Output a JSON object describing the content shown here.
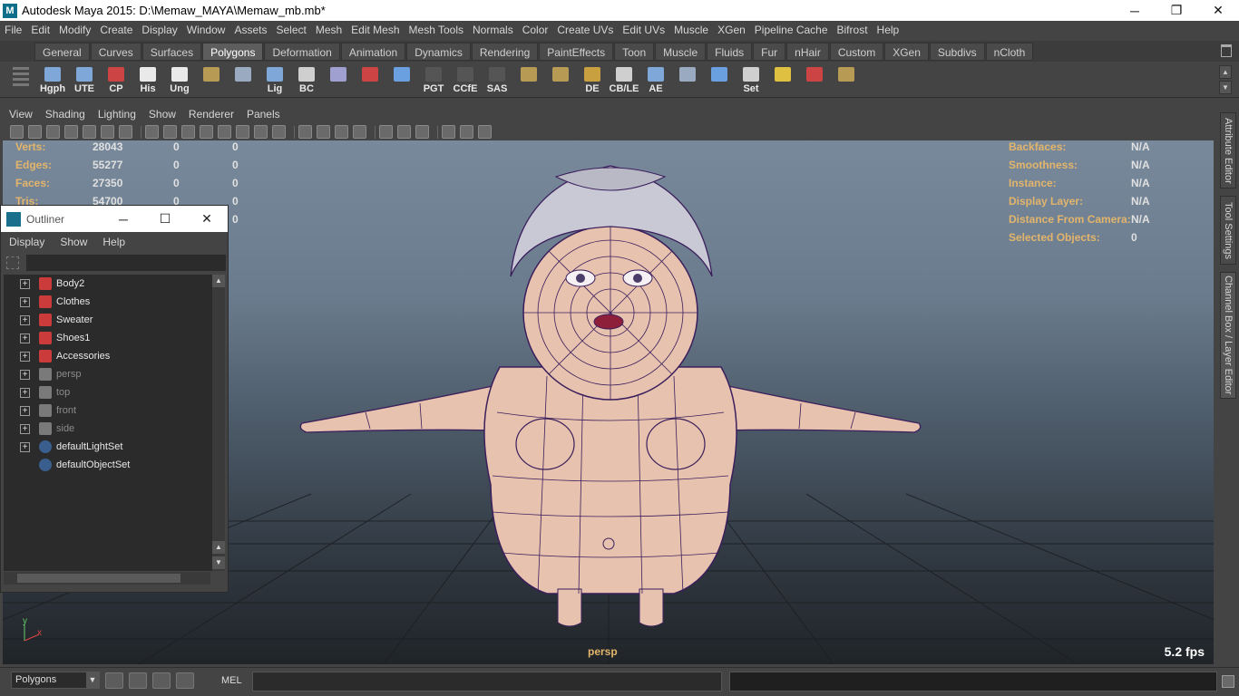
{
  "window": {
    "title": "Autodesk Maya 2015: D:\\Memaw_MAYA\\Memaw_mb.mb*",
    "app_icon": "M",
    "min_glyph": "─",
    "max_glyph": "❐",
    "close_glyph": "✕"
  },
  "menubar": [
    "File",
    "Edit",
    "Modify",
    "Create",
    "Display",
    "Window",
    "Assets",
    "Select",
    "Mesh",
    "Edit Mesh",
    "Mesh Tools",
    "Normals",
    "Color",
    "Create UVs",
    "Edit UVs",
    "Muscle",
    "XGen",
    "Pipeline Cache",
    "Bifrost",
    "Help"
  ],
  "shelf_tabs": [
    "General",
    "Curves",
    "Surfaces",
    "Polygons",
    "Deformation",
    "Animation",
    "Dynamics",
    "Rendering",
    "PaintEffects",
    "Toon",
    "Muscle",
    "Fluids",
    "Fur",
    "nHair",
    "Custom",
    "XGen",
    "Subdivs",
    "nCloth"
  ],
  "shelf_active_tab": "Polygons",
  "shelf_buttons": [
    {
      "label": "Hgph",
      "icon": "hypergraph-icon",
      "color": "#7fa7d8"
    },
    {
      "label": "UTE",
      "icon": "uv-editor-icon",
      "color": "#7fa7d8"
    },
    {
      "label": "CP",
      "icon": "create-poly-icon",
      "color": "#c44"
    },
    {
      "label": "His",
      "icon": "history-icon",
      "color": "#e9e9e9"
    },
    {
      "label": "Ung",
      "icon": "ungroup-icon",
      "color": "#e9e9e9"
    },
    {
      "label": "",
      "icon": "brick-icon",
      "color": "#b79b55"
    },
    {
      "label": "",
      "icon": "sphere-cursor-icon",
      "color": "#9aaac0"
    },
    {
      "label": "Lig",
      "icon": "light-icon",
      "color": "#7fa7d8"
    },
    {
      "label": "BC",
      "icon": "eye-icon",
      "color": "#cfcfcf"
    },
    {
      "label": "",
      "icon": "cube-spark-icon",
      "color": "#a0a0d0"
    },
    {
      "label": "",
      "icon": "camera-spark-icon",
      "color": "#c44"
    },
    {
      "label": "",
      "icon": "curve-icon",
      "color": "#6aa0e0"
    },
    {
      "label": "PGT",
      "icon": "pgt-icon",
      "color": "#555"
    },
    {
      "label": "CCfE",
      "icon": "ccfe-icon",
      "color": "#555"
    },
    {
      "label": "SAS",
      "icon": "sas-icon",
      "color": "#555"
    },
    {
      "label": "",
      "icon": "tile-icon",
      "color": "#b79b55"
    },
    {
      "label": "",
      "icon": "tile-grid-icon",
      "color": "#b79b55"
    },
    {
      "label": "DE",
      "icon": "display-edit-icon",
      "color": "#c8a040"
    },
    {
      "label": "CB/LE",
      "icon": "channel-box-icon",
      "color": "#cfcfcf"
    },
    {
      "label": "AE",
      "icon": "attribute-editor-icon",
      "color": "#7fa7d8"
    },
    {
      "label": "",
      "icon": "shell-icon",
      "color": "#9aaac0"
    },
    {
      "label": "",
      "icon": "spline-icon",
      "color": "#6aa0e0"
    },
    {
      "label": "Set",
      "icon": "key-icon",
      "color": "#cfcfcf"
    },
    {
      "label": "",
      "icon": "target-icon",
      "color": "#e0c040"
    },
    {
      "label": "",
      "icon": "globe-target-icon",
      "color": "#c44"
    },
    {
      "label": "",
      "icon": "stack-icon",
      "color": "#b79b55"
    }
  ],
  "panel_menu": [
    "View",
    "Shading",
    "Lighting",
    "Show",
    "Renderer",
    "Panels"
  ],
  "hud_left": [
    {
      "label": "Verts:",
      "v1": "28043",
      "v2": "0",
      "v3": "0"
    },
    {
      "label": "Edges:",
      "v1": "55277",
      "v2": "0",
      "v3": "0"
    },
    {
      "label": "Faces:",
      "v1": "27350",
      "v2": "0",
      "v3": "0"
    },
    {
      "label": "Tris:",
      "v1": "54700",
      "v2": "0",
      "v3": "0"
    },
    {
      "label": "",
      "v1": "",
      "v2": "",
      "v3": "0"
    }
  ],
  "hud_right": [
    {
      "label": "Backfaces:",
      "value": "N/A"
    },
    {
      "label": "Smoothness:",
      "value": "N/A"
    },
    {
      "label": "Instance:",
      "value": "N/A"
    },
    {
      "label": "Display Layer:",
      "value": "N/A"
    },
    {
      "label": "Distance From Camera:",
      "value": "N/A"
    },
    {
      "label": "Selected Objects:",
      "value": "0"
    }
  ],
  "camera_label": "persp",
  "fps": "5.2 fps",
  "axis": {
    "y": "y",
    "x": "x"
  },
  "right_dock_tabs": [
    "Attribute Editor",
    "Tool Settings",
    "Channel Box / Layer Editor"
  ],
  "outliner": {
    "title": "Outliner",
    "menu": [
      "Display",
      "Show",
      "Help"
    ],
    "search_value": "",
    "items": [
      {
        "label": "Body2",
        "icon": "mesh-icon",
        "dim": false,
        "expand": true
      },
      {
        "label": "Clothes",
        "icon": "mesh-icon",
        "dim": false,
        "expand": true
      },
      {
        "label": "Sweater",
        "icon": "mesh-icon",
        "dim": false,
        "expand": true
      },
      {
        "label": "Shoes1",
        "icon": "mesh-icon",
        "dim": false,
        "expand": true
      },
      {
        "label": "Accessories",
        "icon": "mesh-icon",
        "dim": false,
        "expand": true
      },
      {
        "label": "persp",
        "icon": "camera-icon",
        "dim": true,
        "expand": true
      },
      {
        "label": "top",
        "icon": "camera-icon",
        "dim": true,
        "expand": true
      },
      {
        "label": "front",
        "icon": "camera-icon",
        "dim": true,
        "expand": true
      },
      {
        "label": "side",
        "icon": "camera-icon",
        "dim": true,
        "expand": true
      },
      {
        "label": "defaultLightSet",
        "icon": "set-icon",
        "dim": false,
        "expand": true
      },
      {
        "label": "defaultObjectSet",
        "icon": "set-icon",
        "dim": false,
        "expand": false
      }
    ]
  },
  "cmdline": {
    "menu_set": "Polygons",
    "mel_label": "MEL"
  },
  "colors": {
    "hud_label": "#e3b56b",
    "wireframe": "#3b1f5c",
    "skin": "#e7c2ae"
  }
}
